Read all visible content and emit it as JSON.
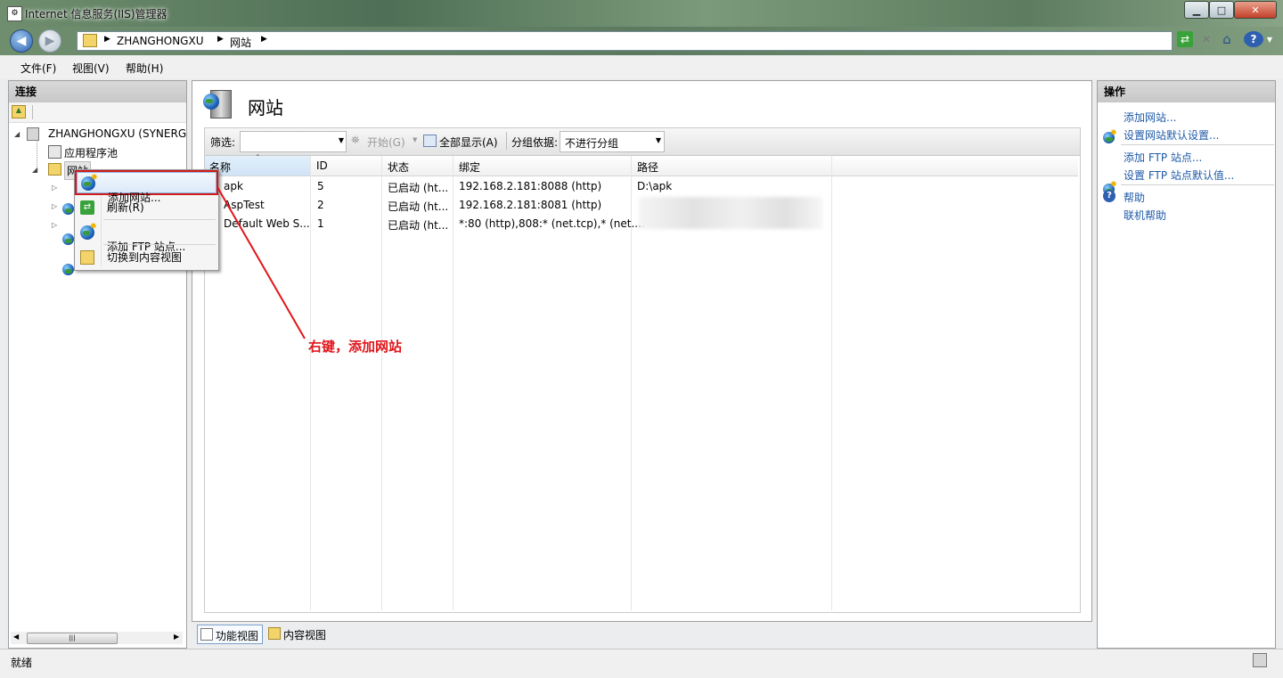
{
  "window": {
    "title": "Internet 信息服务(IIS)管理器"
  },
  "address": {
    "segments": [
      "ZHANGHONGXU",
      "网站"
    ]
  },
  "menu": [
    "文件(F)",
    "视图(V)",
    "帮助(H)"
  ],
  "connections": {
    "header": "连接",
    "tree": {
      "server": "ZHANGHONGXU (SYNERG",
      "app_pools": "应用程序池",
      "sites": "网站"
    }
  },
  "main": {
    "title": "网站",
    "filter": {
      "label": "筛选:",
      "start_label": "开始(G)",
      "show_all_label": "全部显示(A)",
      "group_label": "分组依据:",
      "group_value": "不进行分组"
    },
    "columns": [
      "名称",
      "ID",
      "状态",
      "绑定",
      "路径"
    ],
    "rows": [
      {
        "name": "apk",
        "id": "5",
        "status": "已启动 (ht...",
        "binding": "192.168.2.181:8088 (http)",
        "path": "D:\\apk"
      },
      {
        "name": "AspTest",
        "id": "2",
        "status": "已启动 (ht...",
        "binding": "192.168.2.181:8081 (http)",
        "path": ""
      },
      {
        "name": "Default Web S...",
        "id": "1",
        "status": "已启动 (ht...",
        "binding": "*:80 (http),808:* (net.tcp),* (net....",
        "path": ""
      }
    ],
    "view_tabs": [
      "功能视图",
      "内容视图"
    ]
  },
  "actions": {
    "header": "操作",
    "items": [
      "添加网站...",
      "设置网站默认设置...",
      "添加 FTP 站点...",
      "设置 FTP 站点默认值...",
      "帮助",
      "联机帮助"
    ]
  },
  "context_menu": [
    "添加网站...",
    "刷新(R)",
    "添加 FTP 站点...",
    "切换到内容视图"
  ],
  "annotation": "右键，添加网站",
  "status": "就绪",
  "colors": {
    "accent_link": "#1e5aa8",
    "annotation": "#e0161b"
  }
}
